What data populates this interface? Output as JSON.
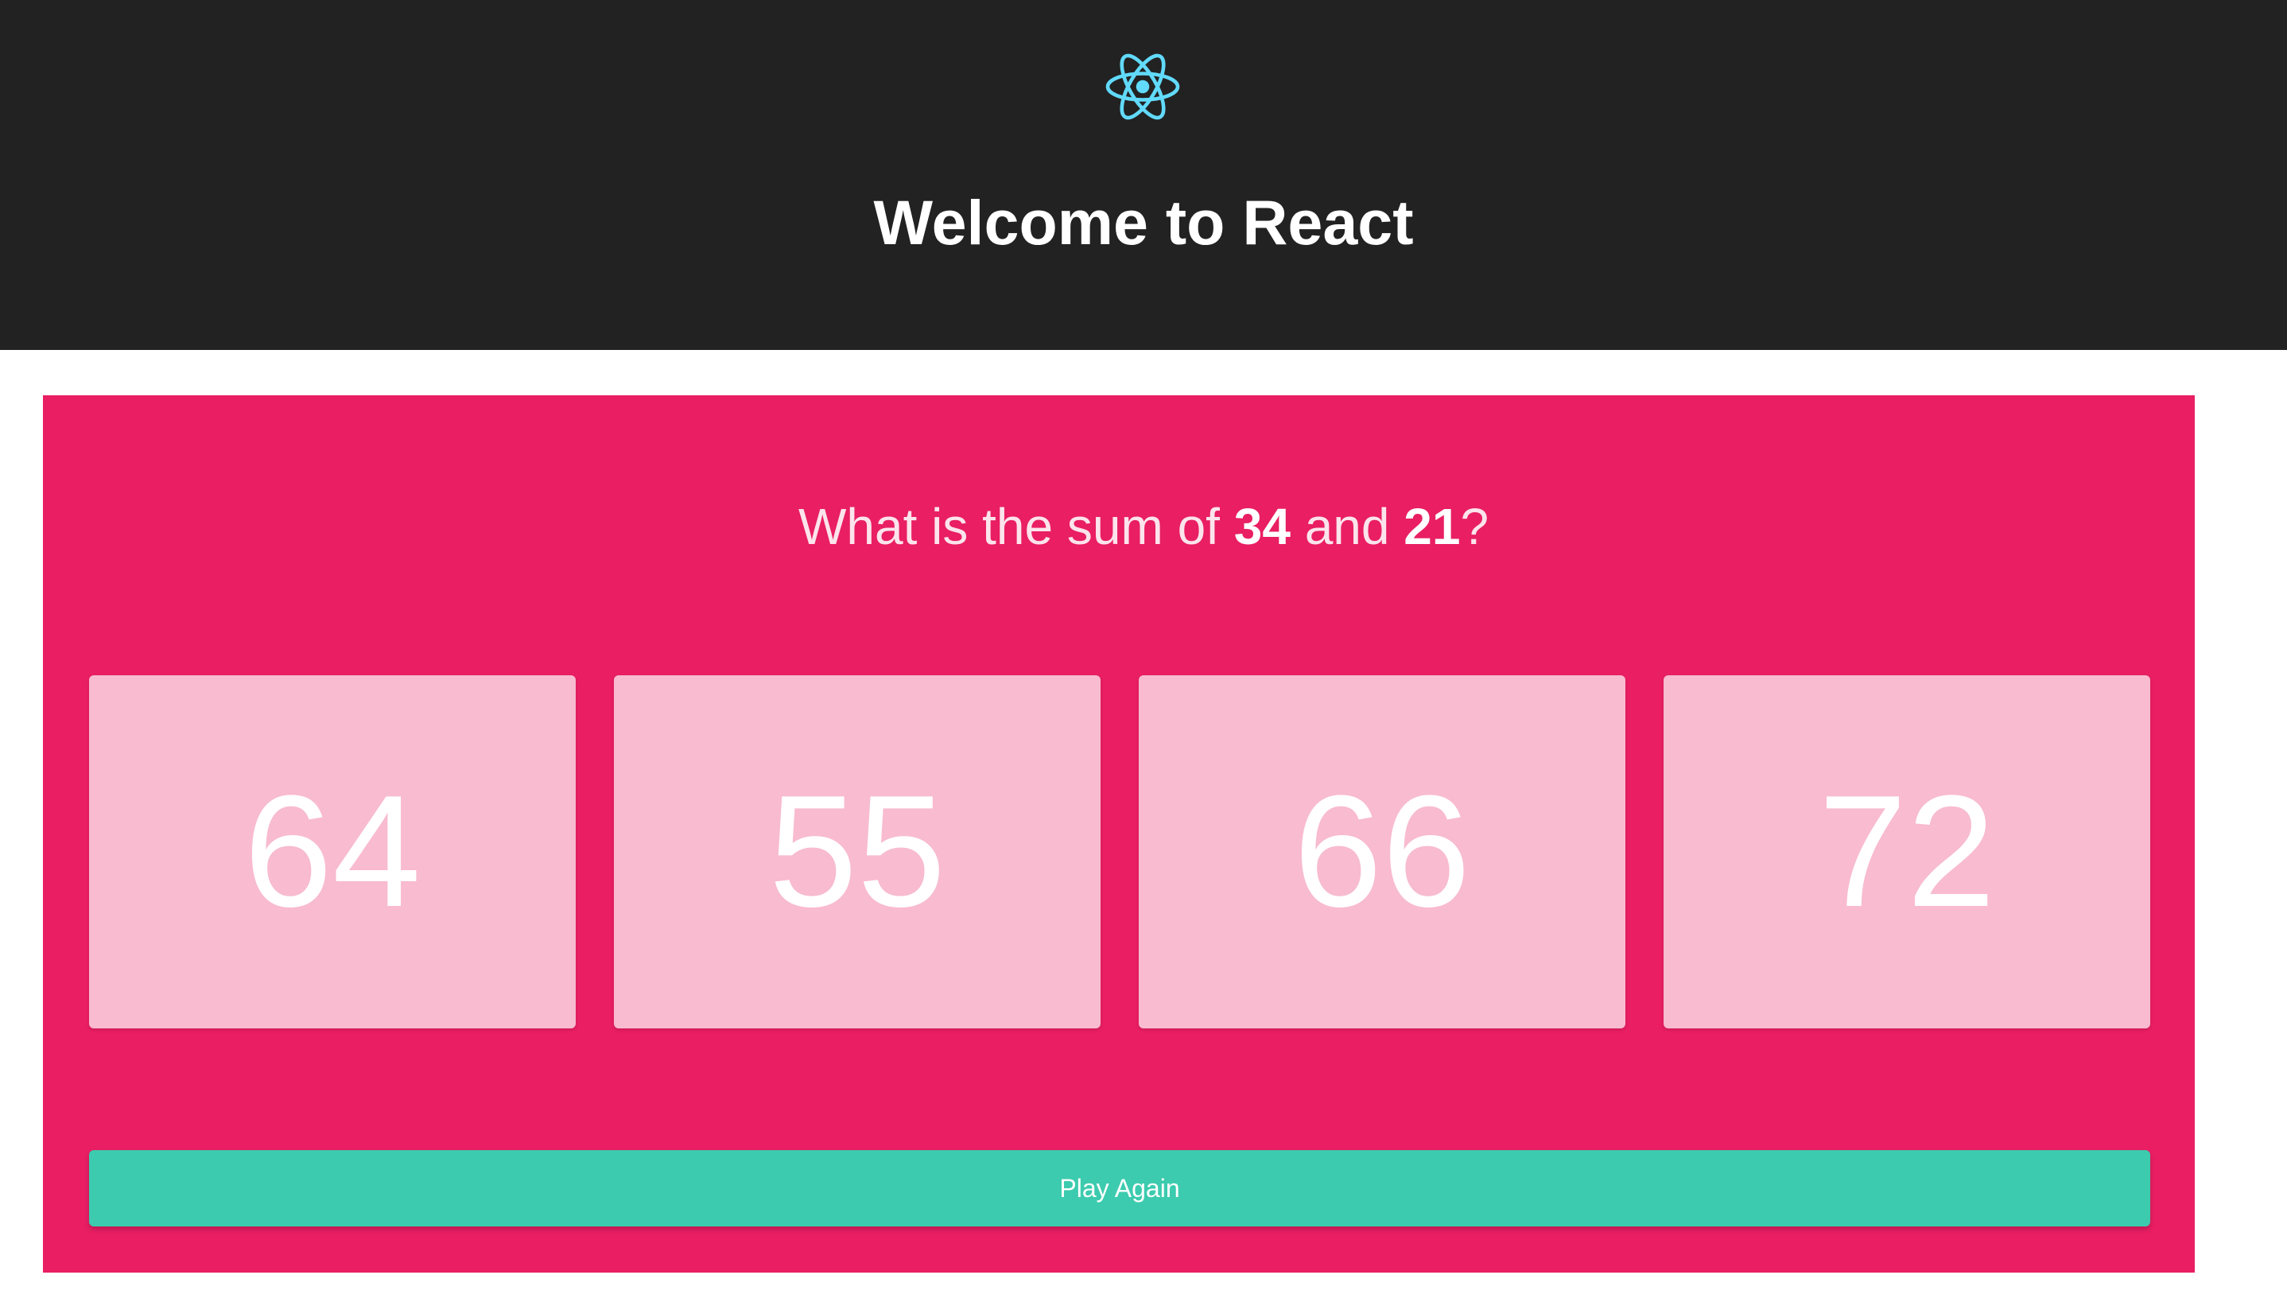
{
  "header": {
    "logo_icon": "react-atom-icon",
    "logo_color": "#61dafb",
    "title": "Welcome to React"
  },
  "question": {
    "prefix": "What is the sum of ",
    "first_number": "34",
    "conjunction": " and ",
    "second_number": "21",
    "suffix": "?"
  },
  "answers": [
    {
      "value": "64"
    },
    {
      "value": "55"
    },
    {
      "value": "66"
    },
    {
      "value": "72"
    }
  ],
  "play_again_label": "Play Again",
  "colors": {
    "header_bg": "#222222",
    "card_bg": "#e91e63",
    "tile_bg": "#f8bbd0",
    "button_bg": "#3ccbae"
  }
}
